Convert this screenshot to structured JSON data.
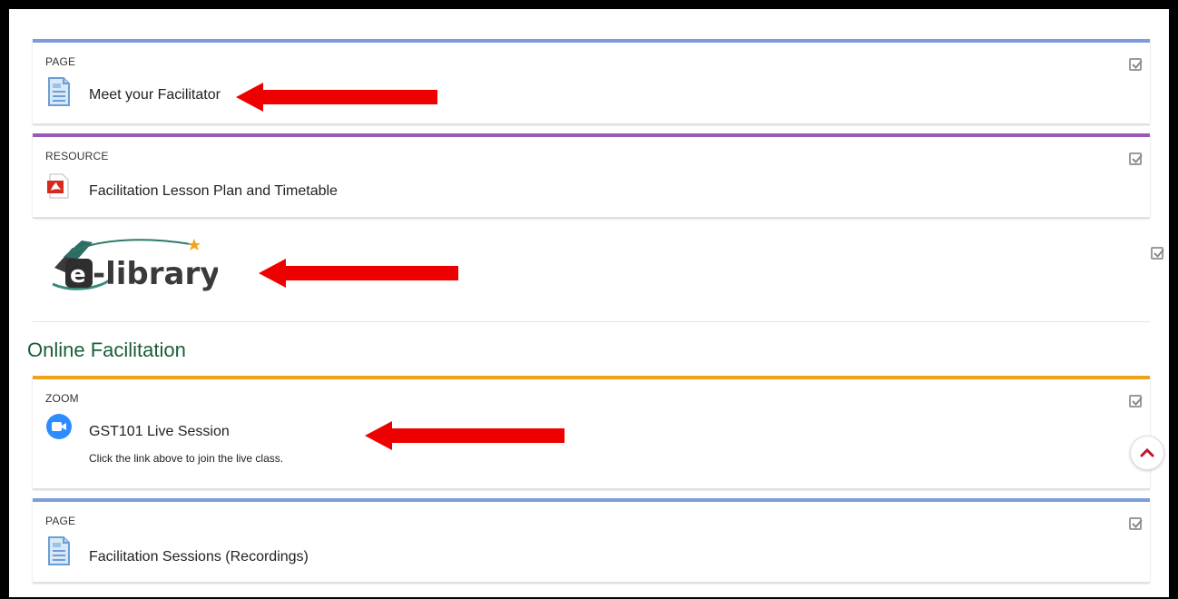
{
  "colors": {
    "page_bar": "#7b9edb",
    "resource_bar": "#9b59b6",
    "zoom_bar": "#f0a31a",
    "section_title": "#1a5e3a",
    "arrow": "#ee0000"
  },
  "items": [
    {
      "type": "PAGE",
      "title": "Meet your Facilitator",
      "icon": "page-icon"
    },
    {
      "type": "RESOURCE",
      "title": "Facilitation Lesson Plan and Timetable",
      "icon": "pdf-icon"
    },
    {
      "type": "",
      "title": "",
      "icon": "elibrary-logo",
      "logo_text": "e-library"
    },
    {
      "type": "ZOOM",
      "title": "GST101 Live Session",
      "icon": "zoom-icon",
      "description": "Click the link above to join the live class."
    },
    {
      "type": "PAGE",
      "title": "Facilitation Sessions (Recordings)",
      "icon": "page-icon"
    }
  ],
  "section": {
    "title": "Online Facilitation"
  }
}
